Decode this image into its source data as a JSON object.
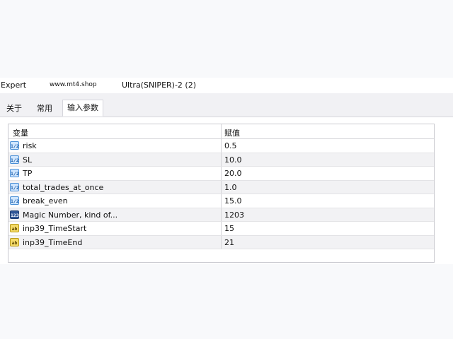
{
  "window": {
    "label": "Expert",
    "site": "www.mt4.shop",
    "name": "Ultra(SNIPER)-2 (2)"
  },
  "tabs": [
    {
      "label": "关于",
      "active": false
    },
    {
      "label": "常用",
      "active": false
    },
    {
      "label": "输入参数",
      "active": true
    }
  ],
  "grid": {
    "header_variable": "变量",
    "header_value": "赋值",
    "rows": [
      {
        "type": "double",
        "icon": "double-param-icon",
        "icon_text": "1/2",
        "name": "risk",
        "value": "0.5"
      },
      {
        "type": "double",
        "icon": "double-param-icon",
        "icon_text": "1/2",
        "name": "SL",
        "value": "10.0"
      },
      {
        "type": "double",
        "icon": "double-param-icon",
        "icon_text": "1/2",
        "name": "TP",
        "value": "20.0"
      },
      {
        "type": "double",
        "icon": "double-param-icon",
        "icon_text": "1/2",
        "name": "total_trades_at_once",
        "value": "1.0"
      },
      {
        "type": "double",
        "icon": "double-param-icon",
        "icon_text": "1/2",
        "name": "break_even",
        "value": "15.0"
      },
      {
        "type": "int",
        "icon": "int-param-icon",
        "icon_text": "123",
        "name": "Magic Number, kind of...",
        "value": "1203"
      },
      {
        "type": "string",
        "icon": "string-param-icon",
        "icon_text": "ab",
        "name": "inp39_TimeStart",
        "value": "15"
      },
      {
        "type": "string",
        "icon": "string-param-icon",
        "icon_text": "ab",
        "name": "inp39_TimeEnd",
        "value": "21"
      }
    ]
  },
  "colors": {
    "double_icon": "#cfe6ff",
    "int_icon": "#2f5596",
    "string_icon": "#f6dc6a"
  }
}
